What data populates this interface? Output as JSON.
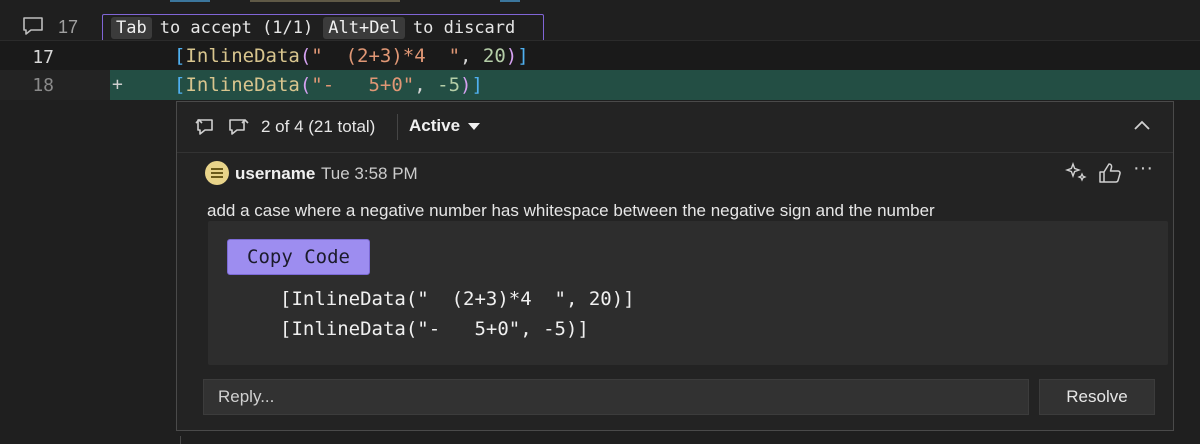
{
  "hint": {
    "comment_count": "17",
    "key_accept": "Tab",
    "text_accept": "to accept (1/1)",
    "key_discard": "Alt+Del",
    "text_discard": "to discard"
  },
  "lines": {
    "line17": {
      "number": "17",
      "open_bracket": "[",
      "ident": "InlineData",
      "open_paren": "(",
      "string": "\"  (2+3)*4  \"",
      "comma": ", ",
      "number_arg": "20",
      "close_paren": ")",
      "close_bracket": "]"
    },
    "line18": {
      "number": "18",
      "marker": "+",
      "open_bracket": "[",
      "ident": "InlineData",
      "open_paren": "(",
      "string": "\"-   5+0\"",
      "comma": ", ",
      "number_arg": "-5",
      "close_paren": ")",
      "close_bracket": "]"
    }
  },
  "thread": {
    "nav_label": "2 of 4 (21 total)",
    "status": "Active",
    "icons": {
      "prev": "previous-comment-icon",
      "next": "next-comment-icon",
      "collapse": "chevron-up-icon"
    }
  },
  "comment": {
    "author": "username",
    "time": "Tue 3:58 PM",
    "body": "add a case where a negative number has whitespace between the negative sign and the number",
    "copy_label": "Copy Code",
    "code_lines": [
      "[InlineData(\"  (2+3)*4  \", 20)]",
      "[InlineData(\"-   5+0\", -5)]"
    ],
    "more": "···"
  },
  "reply": {
    "placeholder": "Reply...",
    "resolve_label": "Resolve"
  },
  "colors": {
    "background": "#1f1f1f",
    "added_line": "#234e44",
    "hint_border": "#8065d6",
    "copy_button": "#9d8df0"
  }
}
